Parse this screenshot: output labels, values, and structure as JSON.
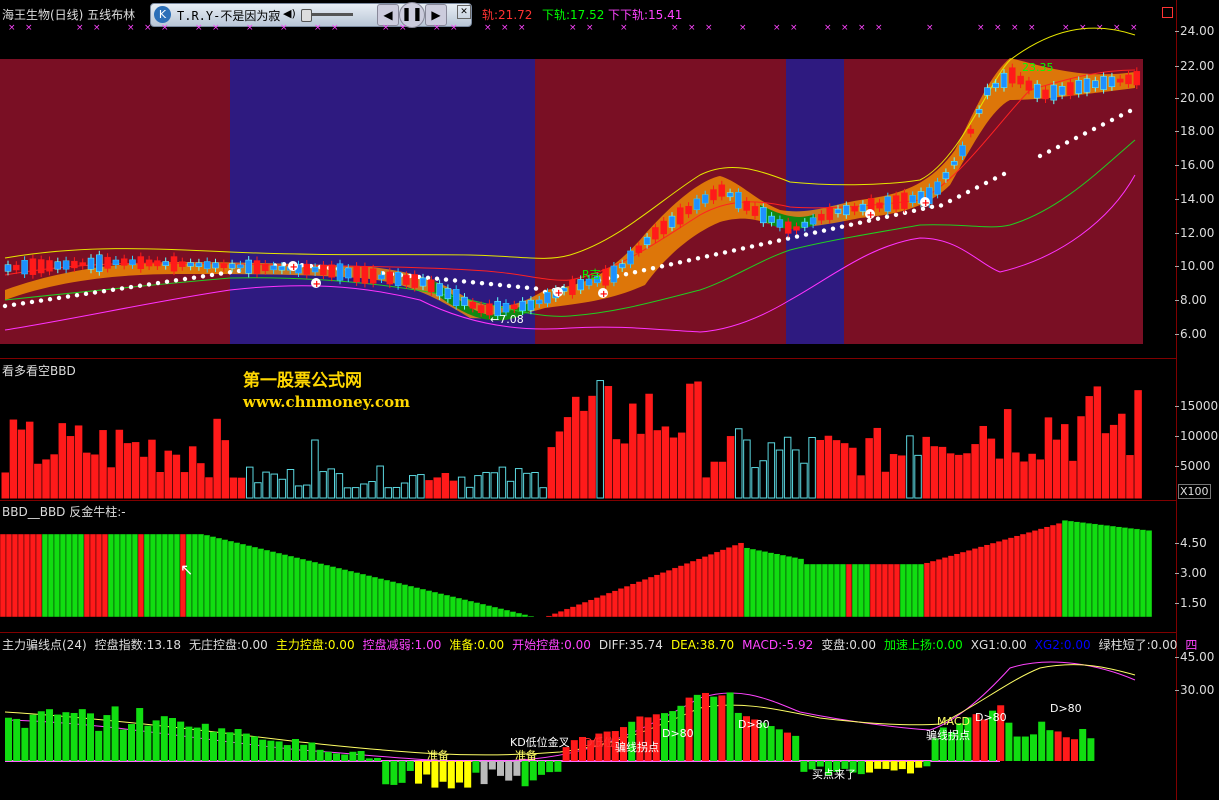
{
  "header": {
    "title": "海王生物(日线) 五线布林",
    "player_text": "T.R.Y-不是因为寂",
    "upper_label": "轨:21.72",
    "lower_label": "下轨:17.52",
    "lowest_label": "下下轨:15.41"
  },
  "price_axis": [
    "24.00",
    "22.00",
    "20.00",
    "18.00",
    "16.00",
    "14.00",
    "12.00",
    "10.00",
    "8.00",
    "6.00"
  ],
  "price_annotations": {
    "low_mark": "←7.08",
    "r_label": "R吉",
    "high_mark": "23.35"
  },
  "pane2": {
    "title": "看多看空BBD",
    "axis": [
      "15000",
      "10000",
      "5000"
    ],
    "unit": "X100"
  },
  "watermark": {
    "line1": "第一股票公式网",
    "line2": "www.chnmoney.com"
  },
  "pane3": {
    "title": "BBD__BBD 反金牛柱:-",
    "axis": [
      "4.50",
      "3.00",
      "1.50"
    ]
  },
  "pane4": {
    "items": [
      {
        "text": "主力骗线点(24)",
        "color": "#dddddd"
      },
      {
        "text": "控盘指数:13.18",
        "color": "#dddddd"
      },
      {
        "text": "无庄控盘:0.00",
        "color": "#dddddd"
      },
      {
        "text": "主力控盘:0.00",
        "color": "#ffff00"
      },
      {
        "text": "控盘减弱:1.00",
        "color": "#ff44ff"
      },
      {
        "text": "准备:0.00",
        "color": "#ffff00"
      },
      {
        "text": "开始控盘:0.00",
        "color": "#ff44ff"
      },
      {
        "text": "DIFF:35.74",
        "color": "#dddddd"
      },
      {
        "text": "DEA:38.70",
        "color": "#ffff00"
      },
      {
        "text": "MACD:-5.92",
        "color": "#ff44ff"
      },
      {
        "text": "变盘:0.00",
        "color": "#dddddd"
      },
      {
        "text": "加速上扬:0.00",
        "color": "#00ff00"
      },
      {
        "text": "XG1:0.00",
        "color": "#dddddd"
      },
      {
        "text": "XG2:0.00",
        "color": "#0000ff"
      },
      {
        "text": "绿柱短了:0.00",
        "color": "#dddddd"
      },
      {
        "text": "四",
        "color": "#ff44ff"
      }
    ],
    "axis": [
      "45.00",
      "30.00"
    ],
    "labels": {
      "zhunbei1": "准备",
      "zhunbei2": "准备",
      "kd": "KD低位金叉",
      "dlow": "D低位",
      "pianxian1": "骗线拐点",
      "d80a": "D>80",
      "d80b": "D>80",
      "d80c": "D>80",
      "d80d": "D>80",
      "macd": "MACD",
      "pianxian2": "骗线拐点",
      "maidian": "买点来了"
    }
  },
  "colors": {
    "up": "#ff0000",
    "down": "#00ff00",
    "maroon_bg": "#7a0f24",
    "blue_bg": "#2e1a80",
    "cyan_bar": "#5bd8e0"
  }
}
